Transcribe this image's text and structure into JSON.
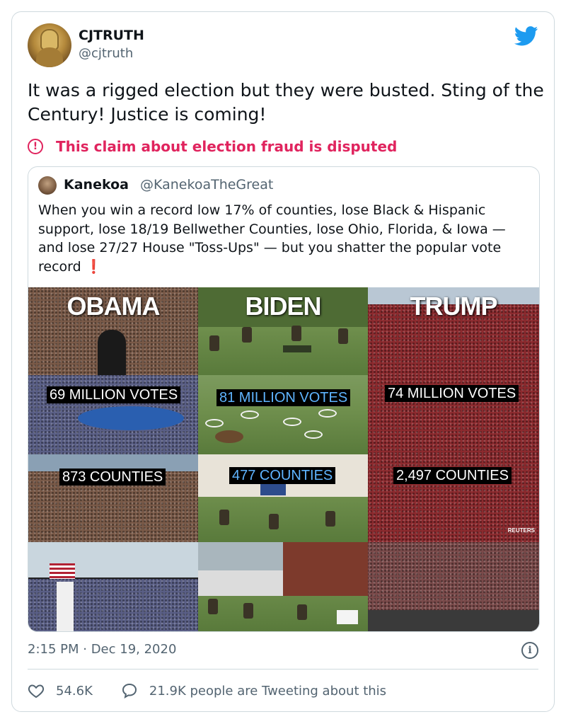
{
  "tweet": {
    "display_name": "CJTRUTH",
    "handle": "@cjtruth",
    "text": "It was a rigged election but they were busted. Sting of the Century! Justice is coming!",
    "disputed_label": "This claim about election fraud is disputed",
    "timestamp": "2:15 PM · Dec 19, 2020",
    "like_count": "54.6K",
    "reply_text": "21.9K people are Tweeting about this"
  },
  "quoted": {
    "display_name": "Kanekoa",
    "handle": "@KanekoaTheGreat",
    "text": "When you win a record low 17% of counties, lose Black & Hispanic support, lose 18/19 Bellwether Counties, lose Ohio, Florida, & Iowa — and lose 27/27 House \"Toss-Ups\" — but you shatter the popular vote record",
    "emphasis": "❗"
  },
  "image": {
    "headers": [
      "OBAMA",
      "BIDEN",
      "TRUMP"
    ],
    "votes": [
      "69 MILLION VOTES",
      "81 MILLION VOTES",
      "74 MILLION VOTES"
    ],
    "counties": [
      "873 COUNTIES",
      "477 COUNTIES",
      "2,497 COUNTIES"
    ],
    "credit": "REUTERS"
  },
  "icons": {
    "brand": "twitter-bird-icon",
    "alert": "alert-circle-icon",
    "info": "info-icon",
    "like": "heart-icon",
    "reply": "speech-bubble-icon"
  },
  "colors": {
    "accent": "#1d9bf0",
    "disputed": "#e0245e",
    "muted": "#536471"
  }
}
